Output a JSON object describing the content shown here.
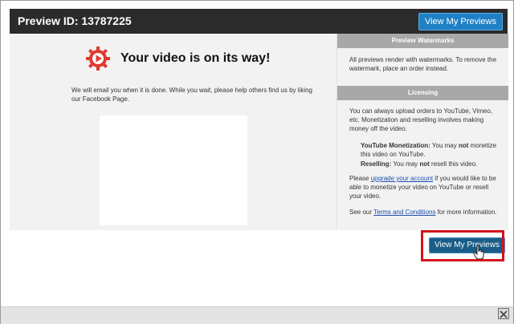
{
  "header": {
    "title": "Preview ID: 13787225",
    "view_previews_label": "View My Previews"
  },
  "main": {
    "title": "Your video is on its way!",
    "text": "We will email you when it is done. While you wait, please help others find us by liking our Facebook Page.",
    "icon": "video-gear-icon"
  },
  "sidebar": {
    "watermarks": {
      "heading": "Preview Watermarks",
      "text": "All previews render with watermarks. To remove the watermark, place an order instead."
    },
    "licensing": {
      "heading": "Licensing",
      "intro": "You can always upload orders to YouTube, Vimeo, etc. Monetization and reselling involves making money off the video.",
      "youtube_label": "YouTube Monetization:",
      "youtube_text_before": " You may ",
      "youtube_not": "not",
      "youtube_text_after": " monetize this video on YouTube.",
      "reselling_label": "Reselling:",
      "reselling_text_before": " You may ",
      "reselling_not": "not",
      "reselling_text_after": " resell this video.",
      "upgrade_before": "Please ",
      "upgrade_link": "upgrade your account",
      "upgrade_after": " if you would like to be able to monetize your video on YouTube or resell your video.",
      "terms_before": "See our ",
      "terms_link": "Terms and Conditions",
      "terms_after": " for more information."
    }
  },
  "footer": {
    "view_previews_label": "View My Previews"
  },
  "colors": {
    "accent": "#1f80c5",
    "highlight": "#d4121b",
    "icon_red": "#e03a2f"
  }
}
